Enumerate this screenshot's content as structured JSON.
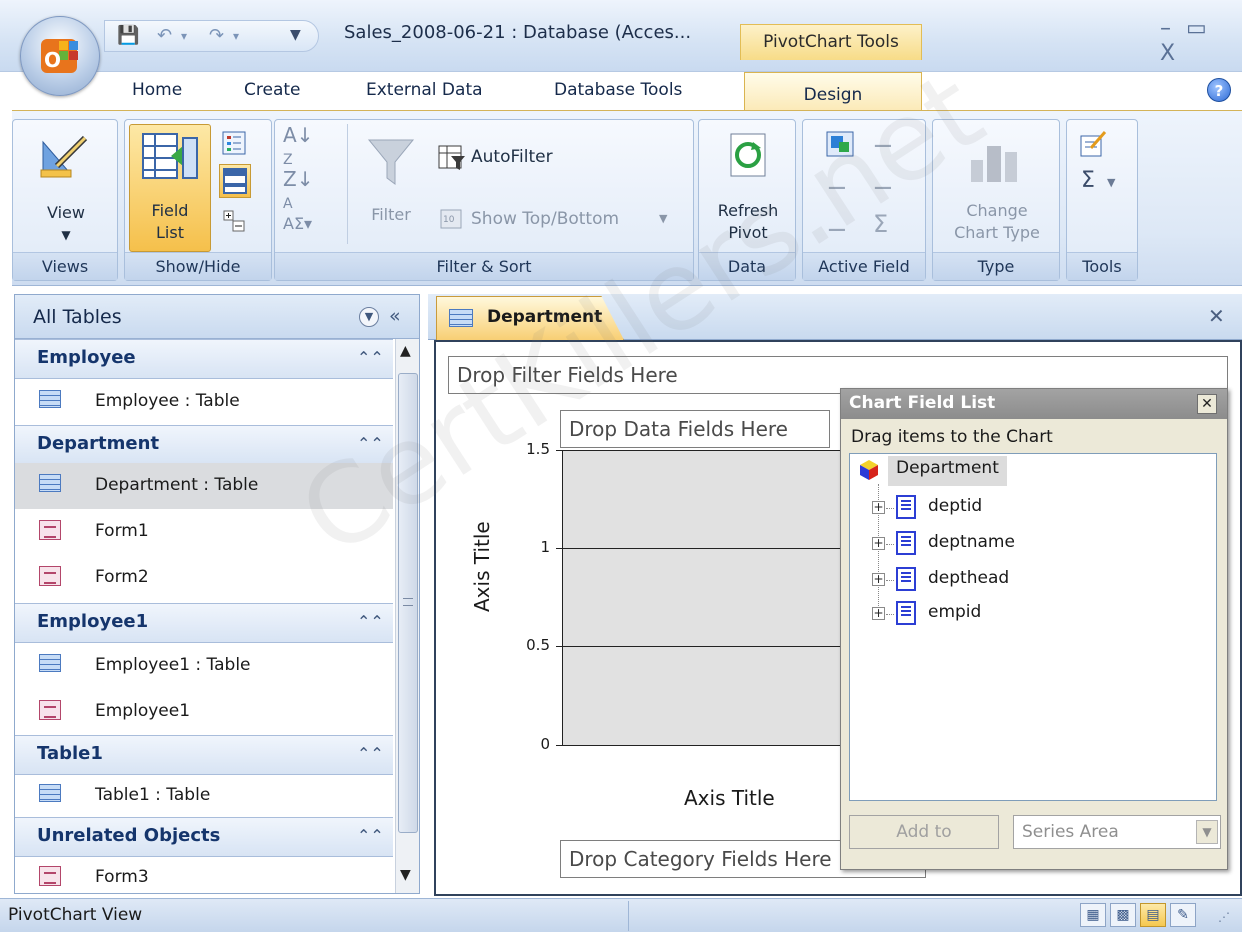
{
  "title_bar": {
    "doc_title": "Sales_2008-06-21 : Database (Acces...",
    "contextual_tab": "PivotChart Tools",
    "window_controls": "– ▭ X"
  },
  "ribbon_tabs": [
    "Home",
    "Create",
    "External Data",
    "Database Tools",
    "Design"
  ],
  "ribbon": {
    "views": {
      "view_label": "View",
      "group_label": "Views"
    },
    "show_hide": {
      "field_list_label_1": "Field",
      "field_list_label_2": "List",
      "group_label": "Show/Hide"
    },
    "filter_sort": {
      "autofilter": "AutoFilter",
      "filter": "Filter",
      "show_top_bottom": "Show Top/Bottom",
      "group_label": "Filter & Sort"
    },
    "data": {
      "refresh_1": "Refresh",
      "refresh_2": "Pivot",
      "group_label": "Data"
    },
    "active_field": {
      "group_label": "Active Field"
    },
    "type": {
      "change_1": "Change",
      "change_2": "Chart Type",
      "group_label": "Type"
    },
    "tools": {
      "group_label": "Tools"
    }
  },
  "nav": {
    "title": "All Tables",
    "groups": [
      {
        "name": "Employee",
        "items": [
          {
            "label": "Employee : Table",
            "icon": "table-icon"
          }
        ]
      },
      {
        "name": "Department",
        "items": [
          {
            "label": "Department : Table",
            "icon": "table-icon",
            "selected": true
          },
          {
            "label": "Form1",
            "icon": "form-icon"
          },
          {
            "label": "Form2",
            "icon": "form-icon"
          }
        ]
      },
      {
        "name": "Employee1",
        "items": [
          {
            "label": "Employee1 : Table",
            "icon": "table-icon"
          },
          {
            "label": "Employee1",
            "icon": "form-icon"
          }
        ]
      },
      {
        "name": "Table1",
        "items": [
          {
            "label": "Table1 : Table",
            "icon": "table-icon"
          }
        ]
      },
      {
        "name": "Unrelated Objects",
        "items": [
          {
            "label": "Form3",
            "icon": "form-icon"
          }
        ]
      }
    ]
  },
  "document": {
    "tab_label": "Department",
    "drop_filter": "Drop Filter Fields Here",
    "drop_data": "Drop Data Fields Here",
    "drop_category": "Drop Category Fields Here",
    "axis_title_y": "Axis Title",
    "axis_title_x": "Axis Title",
    "y_ticks": [
      "1.5",
      "1",
      "0.5",
      "0"
    ]
  },
  "chart_field_list": {
    "title": "Chart Field List",
    "hint": "Drag items to the Chart",
    "root": "Department",
    "fields": [
      "deptid",
      "deptname",
      "depthead",
      "empid"
    ],
    "add_to": "Add to",
    "area_selected": "Series Area"
  },
  "status_bar": {
    "text": "PivotChart View"
  },
  "watermark": "CertKillers.net"
}
